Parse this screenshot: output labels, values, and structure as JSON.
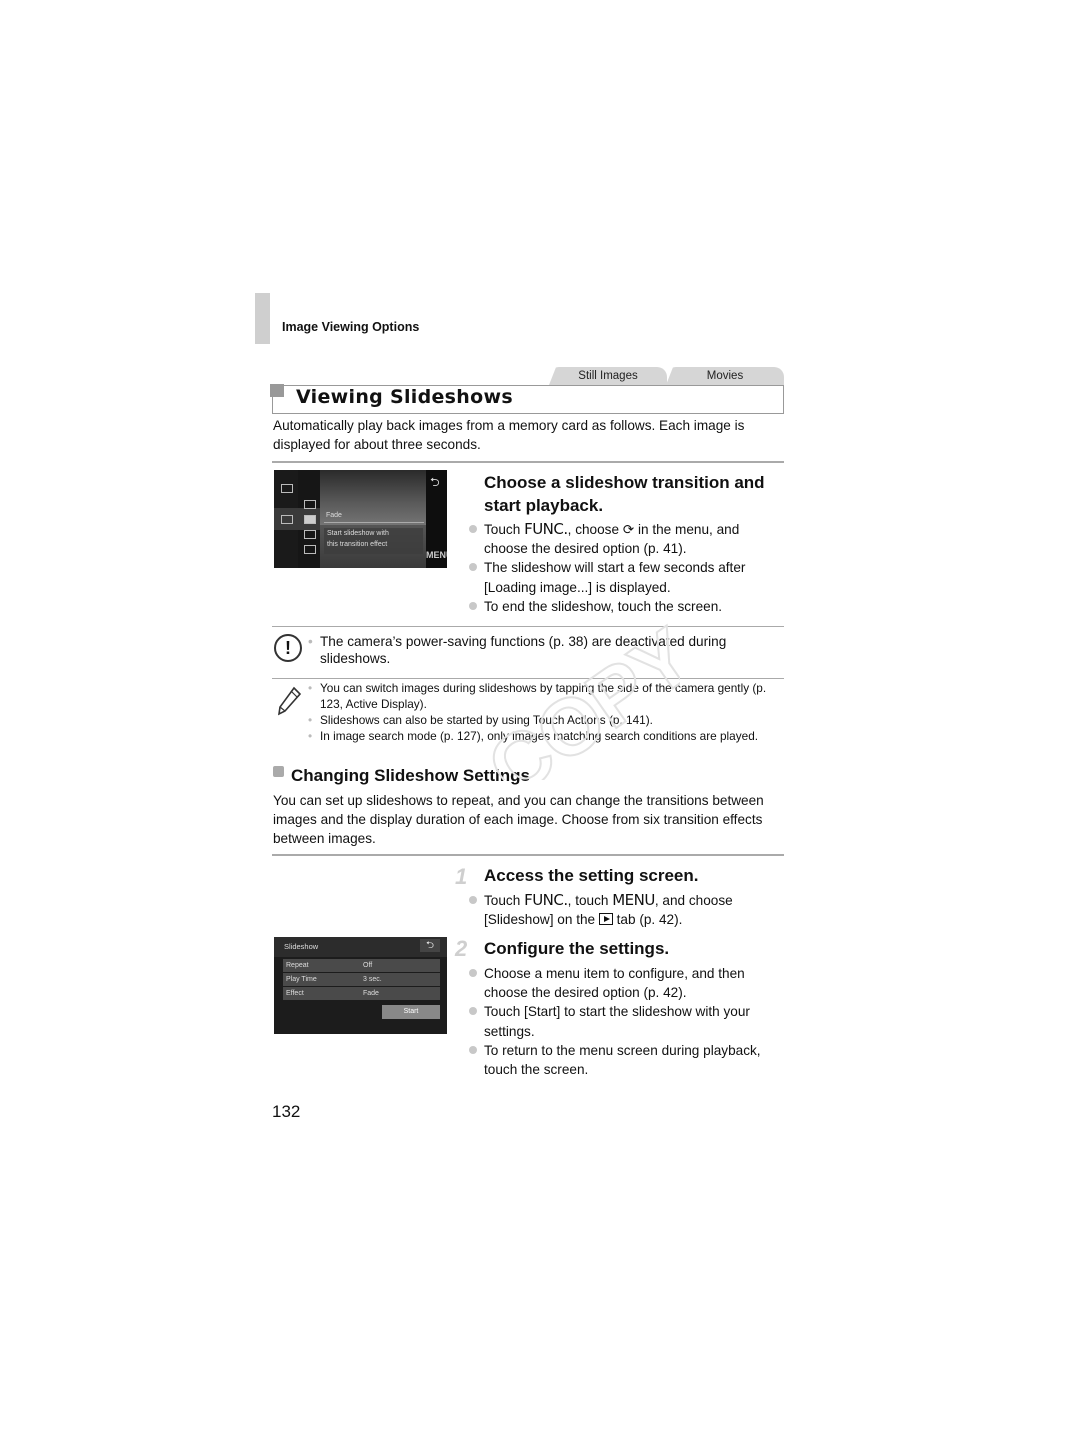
{
  "header": {
    "chapter": "Image Viewing Options"
  },
  "tabs": [
    {
      "label": "Still Images"
    },
    {
      "label": "Movies"
    }
  ],
  "section": {
    "title": "Viewing Slideshows",
    "intro": "Automatically play back images from a memory card as follows. Each image is displayed for about three seconds."
  },
  "step_a": {
    "title": "Choose a slideshow transition and start playback.",
    "bullets": [
      {
        "pre": "Touch ",
        "func": "FUNC.",
        "mid": ", choose ",
        "icon": "⟳",
        "post": " in the menu, and choose the desired option (p. 41)."
      },
      {
        "text": "The slideshow will start a few seconds after [Loading image...] is displayed."
      },
      {
        "text": "To end the slideshow, touch the screen."
      }
    ],
    "screen": {
      "option_label": "Fade",
      "description_line1": "Start slideshow with",
      "description_line2": "this transition effect",
      "back_glyph": "⮌",
      "menu_label": "MENU"
    }
  },
  "caution": {
    "icon": "!",
    "items": [
      "The camera’s power-saving functions (p. 38) are deactivated during slideshows."
    ]
  },
  "notes": {
    "items": [
      "You can switch images during slideshows by tapping the side of the camera gently (p. 123, Active Display).",
      "Slideshows can also be started by using Touch Actions (p. 141).",
      "In image search mode (p. 127), only images matching search conditions are played."
    ]
  },
  "subsection": {
    "title": "Changing Slideshow Settings",
    "intro": "You can set up slideshows to repeat, and you can change the transitions between images and the display duration of each image. Choose from six transition effects between images."
  },
  "steps": [
    {
      "number": "1",
      "title": "Access the setting screen.",
      "bullet": {
        "pre": "Touch ",
        "func": "FUNC.",
        "mid": ", touch ",
        "menu": "MENU",
        "post1": ", and choose [Slideshow] on the ",
        "post2": " tab (p. 42)."
      }
    },
    {
      "number": "2",
      "title": "Configure the settings.",
      "bullets": [
        "Choose a menu item to configure, and then choose the desired option (p. 42).",
        "Touch [Start] to start the slideshow with your settings.",
        "To return to the menu screen during playback, touch the screen."
      ]
    }
  ],
  "settings_screen": {
    "title": "Slideshow",
    "back_glyph": "⮌",
    "rows": [
      {
        "key": "Repeat",
        "value": "Off"
      },
      {
        "key": "Play Time",
        "value": "3 sec."
      },
      {
        "key": "Effect",
        "value": "Fade"
      }
    ],
    "start_label": "Start"
  },
  "footer": {
    "page_number": "132"
  },
  "watermark": {
    "text": "COPY"
  }
}
